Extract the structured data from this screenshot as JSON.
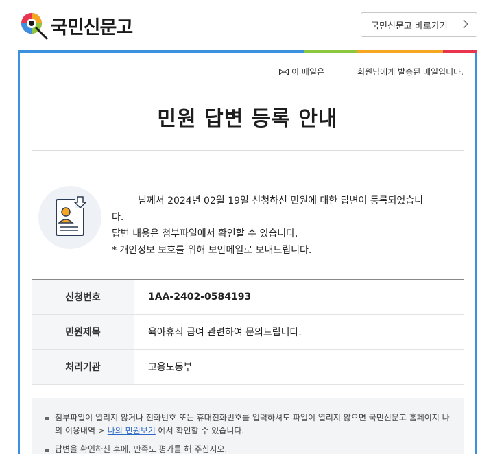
{
  "header": {
    "logo_text": "국민신문고",
    "portal_button_label": "국민신문고 바로가기",
    "portal_button_icon": "chevron-right-icon"
  },
  "colors": {
    "frame_blue": "#3d8fe0",
    "bar_segments": [
      "#3d8fe0",
      "#8dc63f",
      "#f5a623",
      "#e8344e"
    ]
  },
  "notice": {
    "prefix": "이 메일은",
    "suffix": "회원님에게 발송된 메일입니다."
  },
  "title": "민원 답변 등록 안내",
  "message": {
    "line1": "님께서 2024년 02월 19일 신청하신 민원에 대한 답변이 등록되었습니",
    "line1_wrap": "다.",
    "line2": "답변 내용은 첨부파일에서 확인할 수 있습니다.",
    "line3": "* 개인정보 보호를 위해 보안메일로 보내드립니다."
  },
  "info_table": [
    {
      "label": "신청번호",
      "value": "1AA-2402-0584193"
    },
    {
      "label": "민원제목",
      "value": "육아휴직 급여 관련하여 문의드립니다."
    },
    {
      "label": "처리기관",
      "value": "고용노동부"
    }
  ],
  "guide": {
    "item1_text_a": "첨부파일이 열리지 않거나 전화번호 또는 휴대전화번호를 입력하셔도 파일이 열리지 않으면 국민신문고 홈페이지 나의 이용내역 > ",
    "item1_link": "나의 민원보기",
    "item1_text_b": " 에서 확인할 수 있습니다.",
    "item2_text": "답변을 확인하신 후에, 만족도 평가를 해 주십시오."
  }
}
